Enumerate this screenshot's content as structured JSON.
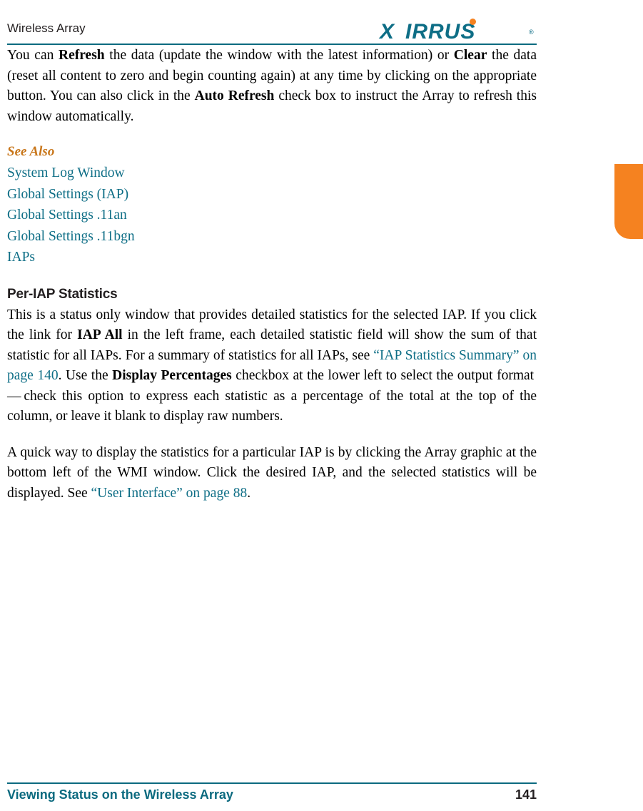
{
  "header": {
    "title": "Wireless Array",
    "logo": {
      "x": "X",
      "text": "IRRUS",
      "reg": "®"
    }
  },
  "content": {
    "intro_paragraph": {
      "seg1": "You can ",
      "bold1": "Refresh",
      "seg2": " the data (update the window with the latest information) or ",
      "bold2": "Clear",
      "seg3": " the data (reset all content to zero and begin counting again) at any time by clicking on the appropriate button. You can also click in the ",
      "bold3": "Auto Refresh",
      "seg4": " check box to instruct the Array to refresh this window automatically."
    },
    "see_also_heading": "See Also",
    "see_also_links": [
      "System Log Window",
      "Global Settings (IAP)",
      "Global Settings .11an",
      "Global Settings .11bgn",
      "IAPs"
    ],
    "section_heading": "Per-IAP Statistics",
    "paragraph2": {
      "seg1": "This is a status only window that provides detailed statistics for the selected IAP. If you click the link for ",
      "bold1": "IAP All",
      "seg2": " in the left frame, each detailed statistic field will show the sum of that statistic for all IAPs. For a summary of statistics for all IAPs, see ",
      "link1": "“IAP Statistics Summary” on page 140",
      "seg3": ". Use the ",
      "bold2": "Display Percentages",
      "seg4": " checkbox at the lower left to select the output format — check this option to express each statistic as a percentage of the total at the top of the column, or leave it blank to display raw numbers."
    },
    "paragraph3": {
      "seg1": "A quick way to display the statistics for a particular IAP is by clicking the Array graphic at the bottom left of the WMI window. Click the desired IAP, and the selected statistics will be displayed. See ",
      "link1": "“User Interface” on page 88",
      "seg2": "."
    }
  },
  "footer": {
    "left": "Viewing Status on the Wireless Array",
    "page": "141"
  },
  "colors": {
    "teal": "#0e6e86",
    "orange": "#f58220",
    "heading_orange": "#c8761a",
    "rule": "#0b6a7f"
  }
}
